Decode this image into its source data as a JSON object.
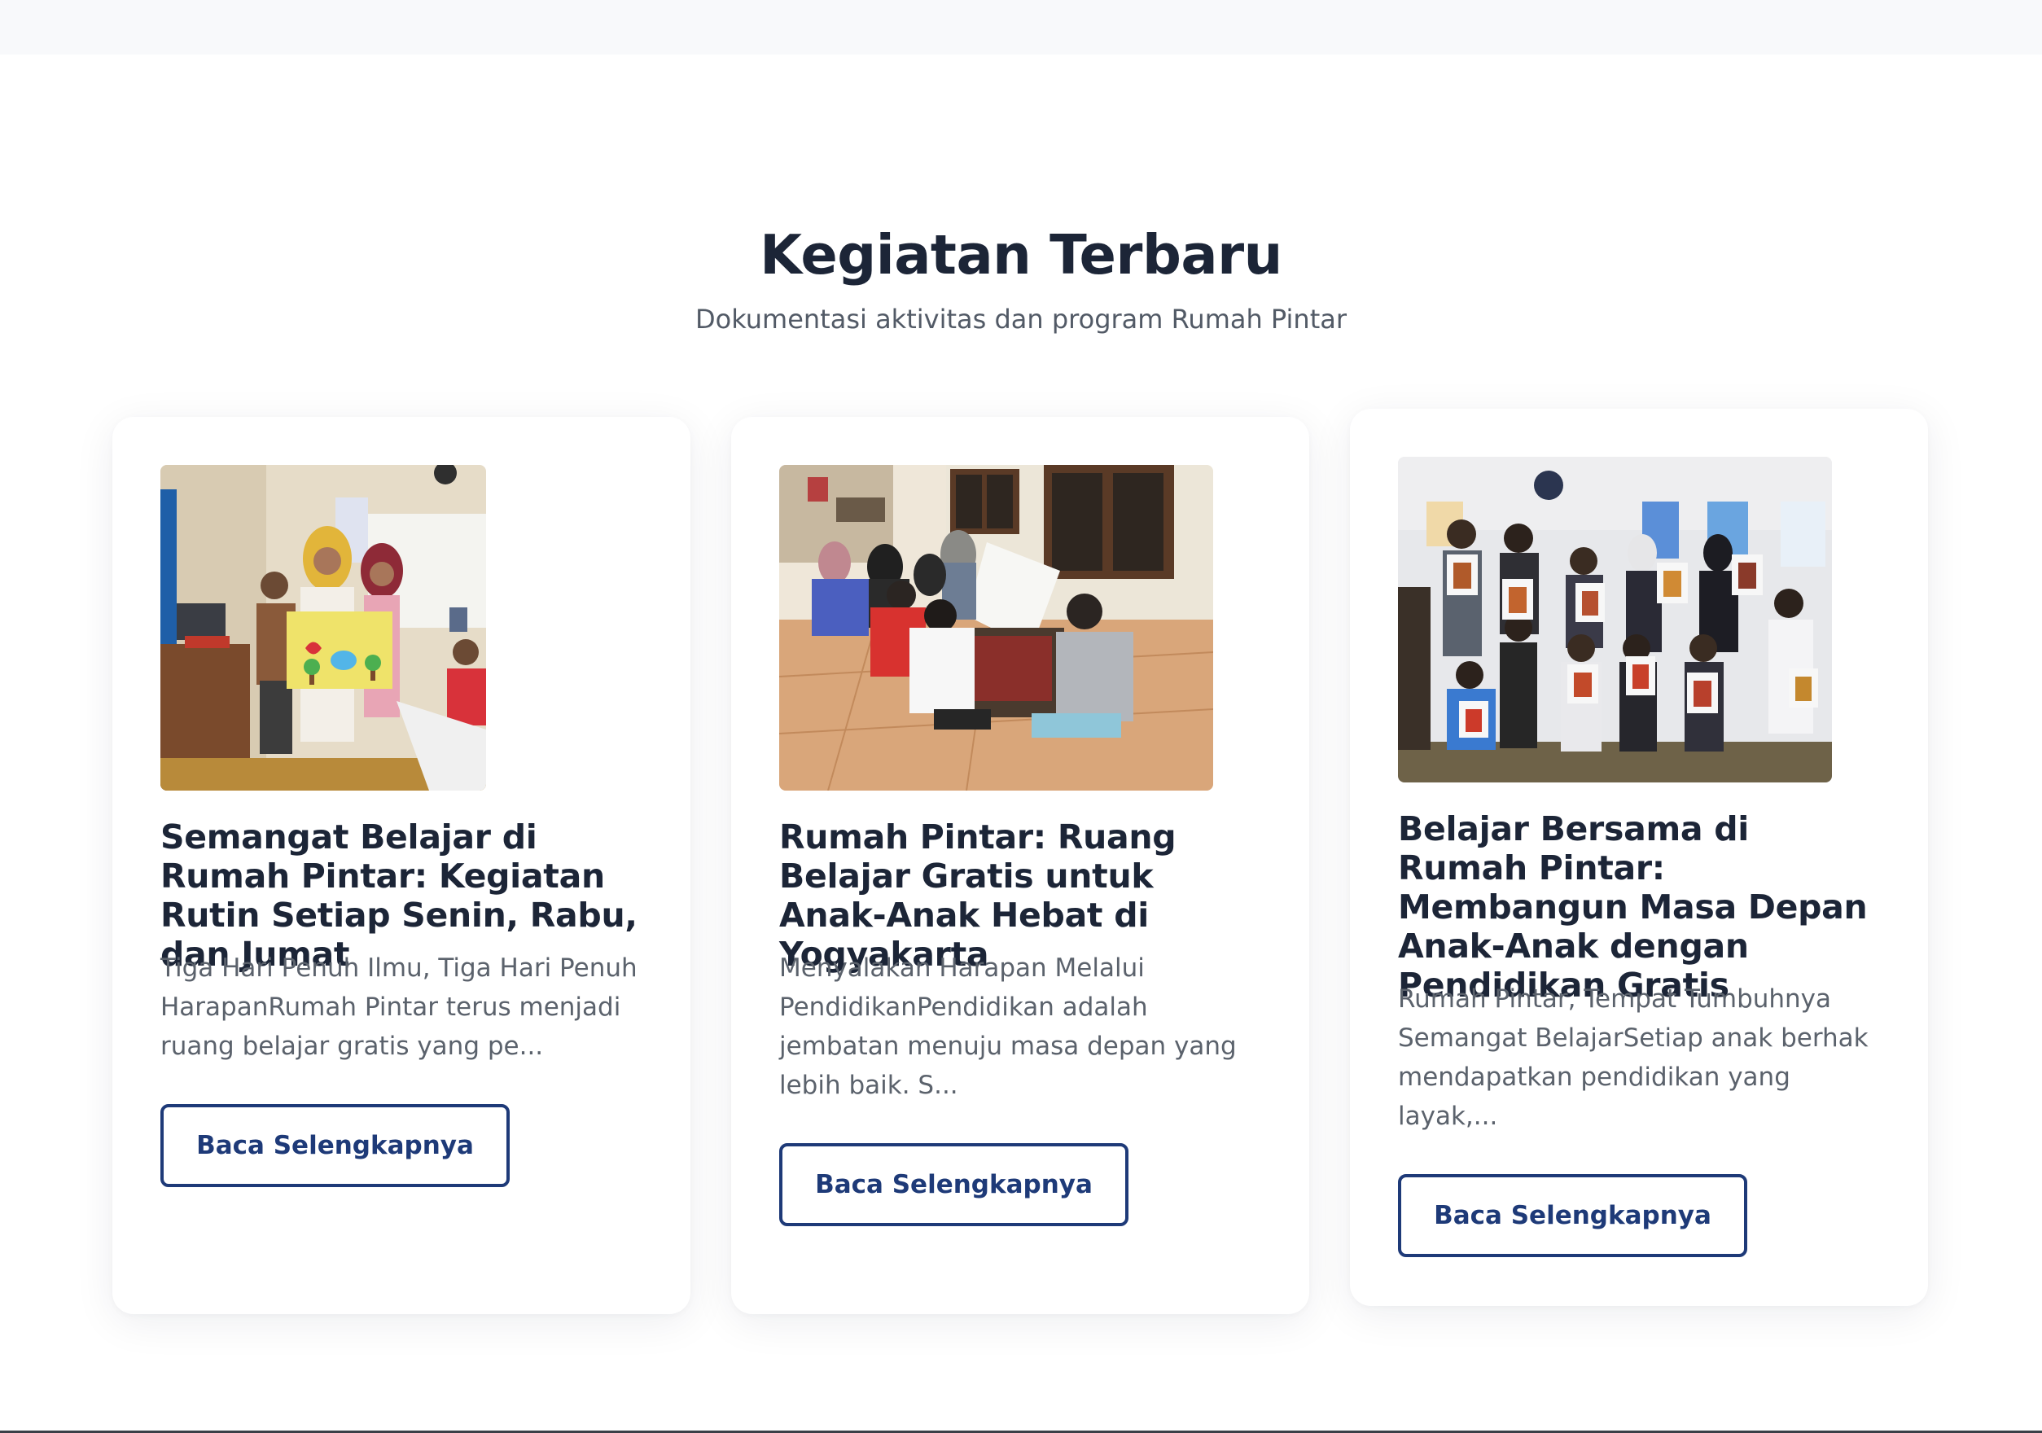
{
  "section": {
    "title": "Kegiatan Terbaru",
    "subtitle": "Dokumentasi aktivitas dan program Rumah Pintar"
  },
  "cards": [
    {
      "title": "Semangat Belajar di Rumah Pintar: Kegiatan Rutin Setiap Senin, Rabu, dan Jumat",
      "excerpt": "Tiga Hari Penuh Ilmu, Tiga Hari Penuh HarapanRumah Pintar terus menjadi ruang belajar gratis yang pe...",
      "button_label": "Baca Selengkapnya"
    },
    {
      "title": "Rumah Pintar: Ruang Belajar Gratis untuk Anak-Anak Hebat di Yogyakarta",
      "excerpt": "Menyalakan Harapan Melalui PendidikanPendidikan adalah jembatan menuju masa depan yang lebih baik. S...",
      "button_label": "Baca Selengkapnya"
    },
    {
      "title": "Belajar Bersama di Rumah Pintar: Membangun Masa Depan Anak-Anak dengan Pendidikan Gratis",
      "excerpt": "Rumah Pintar, Tempat Tumbuhnya Semangat BelajarSetiap anak berhak mendapatkan pendidikan yang layak,...",
      "button_label": "Baca Selengkapnya"
    }
  ],
  "colors": {
    "heading": "#1c2537",
    "body_text": "#5b626c",
    "accent": "#1e3a78",
    "card_bg": "#ffffff",
    "top_strip": "#f8f9fb"
  }
}
